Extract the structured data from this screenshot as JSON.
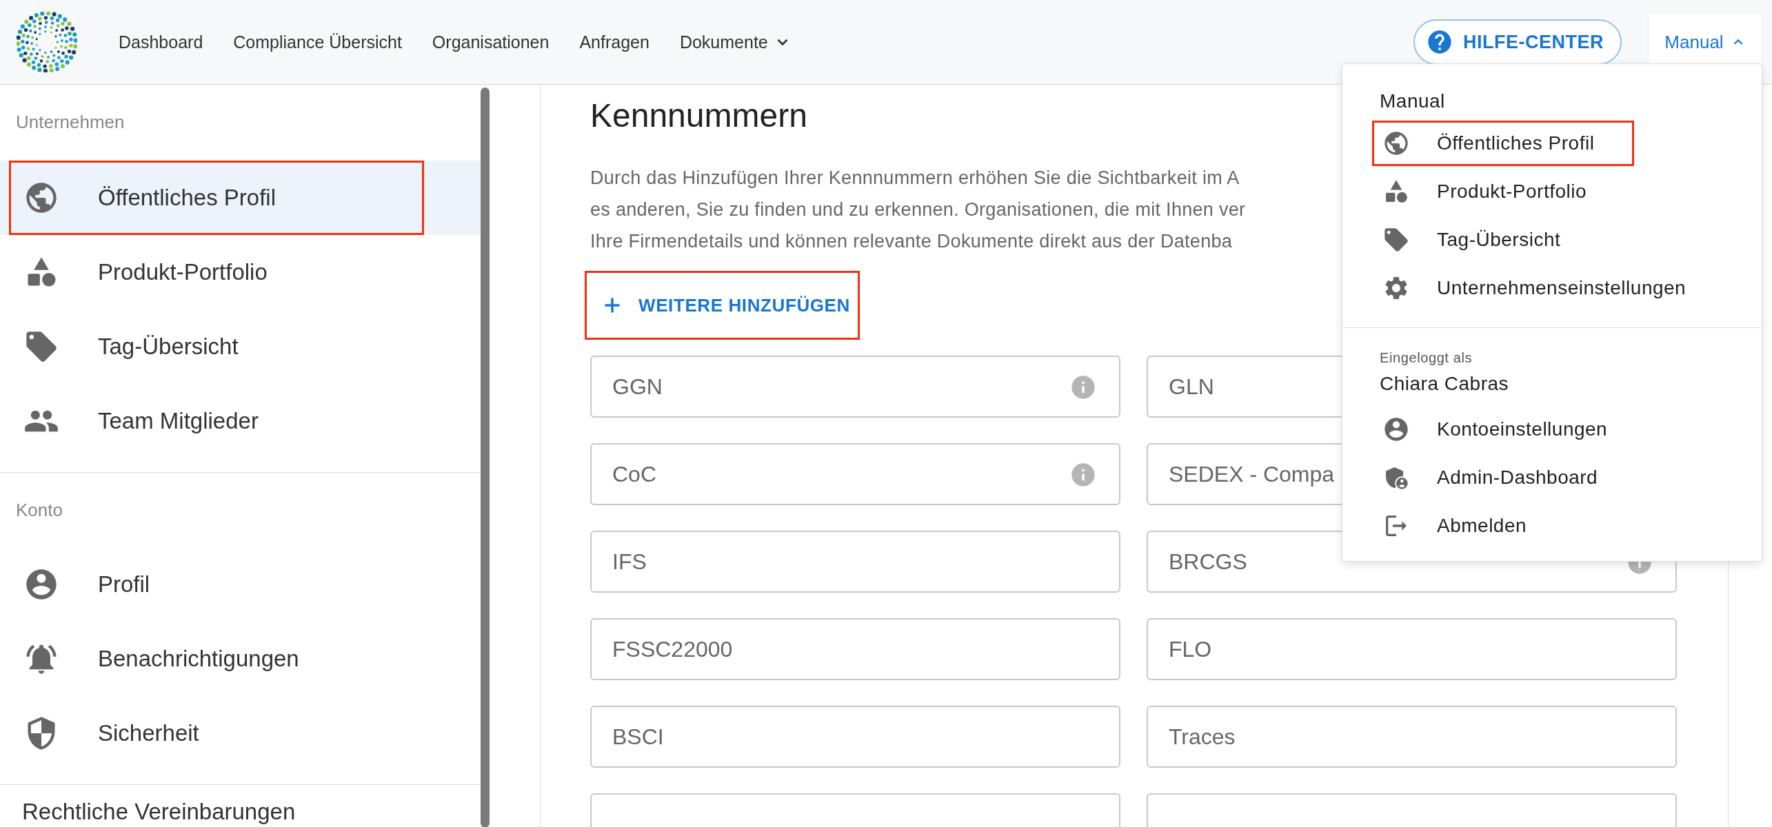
{
  "header": {
    "nav": [
      {
        "label": "Dashboard",
        "has_menu": false
      },
      {
        "label": "Compliance Übersicht",
        "has_menu": false
      },
      {
        "label": "Organisationen",
        "has_menu": false
      },
      {
        "label": "Anfragen",
        "has_menu": false
      },
      {
        "label": "Dokumente",
        "has_menu": true
      }
    ],
    "help_button": {
      "label": "HILFE-CENTER"
    },
    "account_button": {
      "label": "Manual",
      "expanded": true
    }
  },
  "sidebar": {
    "sections": [
      {
        "title": "Unternehmen",
        "items": [
          {
            "label": "Öffentliches Profil",
            "kind": "globe",
            "selected": true,
            "highlighted": true
          },
          {
            "label": "Produkt-Portfolio",
            "kind": "shapes",
            "selected": false,
            "highlighted": false
          },
          {
            "label": "Tag-Übersicht",
            "kind": "tag",
            "selected": false,
            "highlighted": false
          },
          {
            "label": "Team Mitglieder",
            "kind": "team",
            "selected": false,
            "highlighted": false
          }
        ]
      },
      {
        "title": "Konto",
        "items": [
          {
            "label": "Profil",
            "kind": "person",
            "selected": false,
            "highlighted": false
          },
          {
            "label": "Benachrichtigungen",
            "kind": "bell",
            "selected": false,
            "highlighted": false
          },
          {
            "label": "Sicherheit",
            "kind": "shield",
            "selected": false,
            "highlighted": false
          }
        ]
      }
    ],
    "footer_item": "Rechtliche Vereinbarungen"
  },
  "main": {
    "title": "Kennnummern",
    "description": [
      "Durch das Hinzufügen Ihrer Kennnummern erhöhen Sie die Sichtbarkeit im A",
      "es anderen, Sie zu finden und zu erkennen. Organisationen, die mit Ihnen ver",
      "Ihre Firmendetails und können relevante Dokumente direkt aus der Datenba"
    ],
    "add_button": {
      "label": "WEITERE HINZUFÜGEN",
      "highlighted": true
    },
    "fields": [
      {
        "placeholder": "GGN",
        "info": true
      },
      {
        "placeholder": "GLN",
        "info": false
      },
      {
        "placeholder": "CoC",
        "info": true
      },
      {
        "placeholder": "SEDEX - Compa",
        "info": false
      },
      {
        "placeholder": "IFS",
        "info": false
      },
      {
        "placeholder": "BRCGS",
        "info": true
      },
      {
        "placeholder": "FSSC22000",
        "info": false
      },
      {
        "placeholder": "FLO",
        "info": false
      },
      {
        "placeholder": "BSCI",
        "info": false
      },
      {
        "placeholder": "Traces",
        "info": false
      },
      {
        "info": false
      },
      {
        "info": false
      }
    ]
  },
  "account_menu": {
    "title": "Manual",
    "items": [
      {
        "label": "Öffentliches Profil",
        "kind": "globe",
        "highlighted": true
      },
      {
        "label": "Produkt-Portfolio",
        "kind": "shapes",
        "highlighted": false
      },
      {
        "label": "Tag-Übersicht",
        "kind": "tag",
        "highlighted": false
      },
      {
        "label": "Unternehmenseinstellungen",
        "kind": "gear",
        "highlighted": false
      }
    ],
    "user_caption": "Eingeloggt als",
    "user_name": "Chiara Cabras",
    "user_items": [
      {
        "label": "Kontoeinstellungen",
        "kind": "person",
        "highlighted": false
      },
      {
        "label": "Admin-Dashboard",
        "kind": "admin",
        "highlighted": false
      },
      {
        "label": "Abmelden",
        "kind": "logout",
        "highlighted": false
      }
    ]
  }
}
